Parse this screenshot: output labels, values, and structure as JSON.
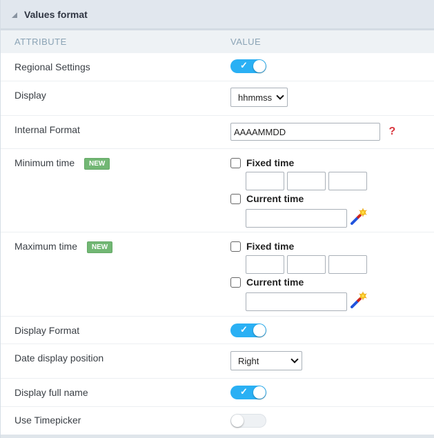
{
  "panel": {
    "title": "Values format"
  },
  "table": {
    "col_attribute": "ATTRIBUTE",
    "col_value": "VALUE"
  },
  "rows": {
    "regional_settings": {
      "label": "Regional Settings",
      "toggle_on": true
    },
    "display": {
      "label": "Display",
      "selected": "hhmmss"
    },
    "internal_format": {
      "label": "Internal Format",
      "value": "AAAAMMDD",
      "help_icon": "?"
    },
    "minimum_time": {
      "label": "Minimum time",
      "badge": "NEW",
      "fixed_label": "Fixed time",
      "fixed_checked": false,
      "current_label": "Current time",
      "current_checked": false,
      "fixed_values": [
        "",
        "",
        ""
      ],
      "current_value": ""
    },
    "maximum_time": {
      "label": "Maximum time",
      "badge": "NEW",
      "fixed_label": "Fixed time",
      "fixed_checked": false,
      "current_label": "Current time",
      "current_checked": false,
      "fixed_values": [
        "",
        "",
        ""
      ],
      "current_value": ""
    },
    "display_format": {
      "label": "Display Format",
      "toggle_on": true
    },
    "date_display_position": {
      "label": "Date display position",
      "selected": "Right"
    },
    "display_full_name": {
      "label": "Display full name",
      "toggle_on": true
    },
    "use_timepicker": {
      "label": "Use Timepicker",
      "toggle_on": false
    }
  },
  "icons": {
    "collapse": "triangle-collapse-icon",
    "check": "✓",
    "help": "question-mark-icon",
    "wand": "magic-wand-icon"
  },
  "colors": {
    "toggle_on": "#2ab0f4",
    "badge_new": "#72b774",
    "help": "#d9363e",
    "header_bg": "#e1e7ee"
  }
}
